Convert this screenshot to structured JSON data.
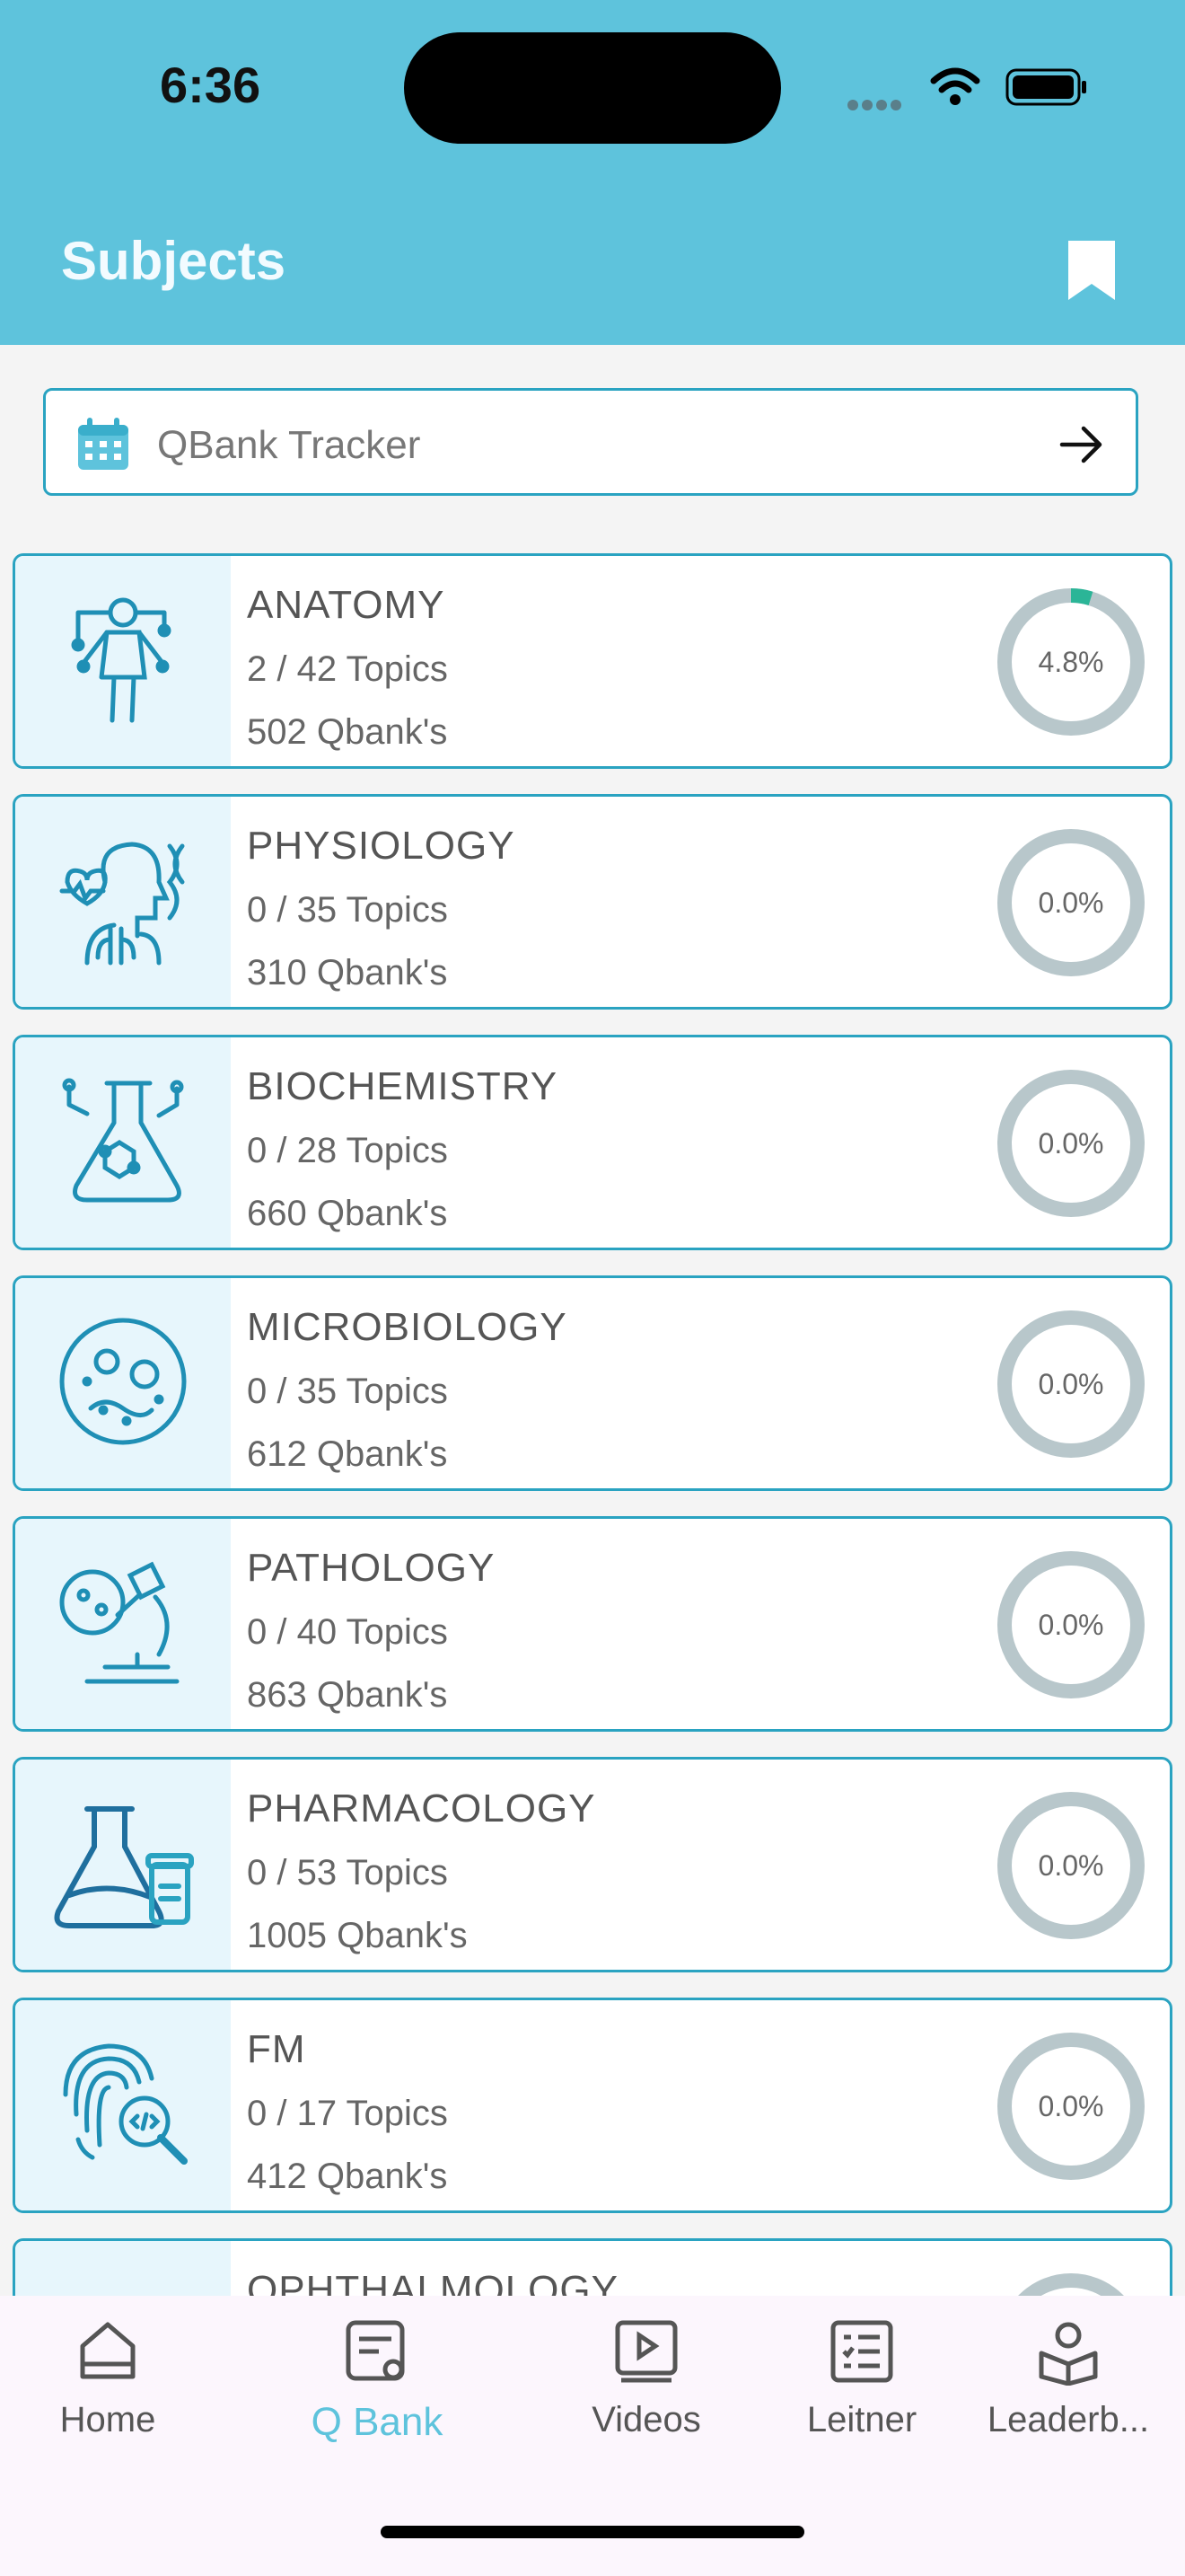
{
  "status": {
    "time": "6:36"
  },
  "header": {
    "title": "Subjects",
    "bookmark_icon": "bookmark-icon"
  },
  "tracker": {
    "label": "QBank Tracker",
    "icon": "calendar-icon",
    "arrow_icon": "arrow-right-icon"
  },
  "colors": {
    "accent": "#5ec3dc",
    "border": "#2aa3c1",
    "progress": "#2bb597",
    "ring_track": "#b8c7cb"
  },
  "subjects": [
    {
      "name": "ANATOMY",
      "topics": "2 / 42 Topics",
      "qbanks": "502 Qbank's",
      "percent_label": "4.8%",
      "progress": 0.048,
      "icon": "human-anatomy-icon"
    },
    {
      "name": "PHYSIOLOGY",
      "topics": "0 / 35 Topics",
      "qbanks": "310 Qbank's",
      "percent_label": "0.0%",
      "progress": 0.0,
      "icon": "physiology-icon"
    },
    {
      "name": "BIOCHEMISTRY",
      "topics": "0 / 28 Topics",
      "qbanks": "660 Qbank's",
      "percent_label": "0.0%",
      "progress": 0.0,
      "icon": "biochemistry-flask-icon"
    },
    {
      "name": "MICROBIOLOGY",
      "topics": "0 / 35 Topics",
      "qbanks": "612 Qbank's",
      "percent_label": "0.0%",
      "progress": 0.0,
      "icon": "microbes-petri-icon"
    },
    {
      "name": "PATHOLOGY",
      "topics": "0 / 40 Topics",
      "qbanks": "863 Qbank's",
      "percent_label": "0.0%",
      "progress": 0.0,
      "icon": "microscope-icon"
    },
    {
      "name": "PHARMACOLOGY",
      "topics": "0 / 53 Topics",
      "qbanks": "1005 Qbank's",
      "percent_label": "0.0%",
      "progress": 0.0,
      "icon": "flask-pill-bottle-icon"
    },
    {
      "name": "FM",
      "topics": "0 / 17 Topics",
      "qbanks": "412 Qbank's",
      "percent_label": "0.0%",
      "progress": 0.0,
      "icon": "fingerprint-search-icon"
    },
    {
      "name": "OPHTHALMOLOGY",
      "topics": "",
      "qbanks": "",
      "percent_label": "",
      "progress": 0.0,
      "icon": "eye-icon"
    }
  ],
  "tabbar": [
    {
      "label": "Home",
      "icon": "home-icon",
      "active": false
    },
    {
      "label": "Q Bank",
      "icon": "qbank-icon",
      "active": true
    },
    {
      "label": "Videos",
      "icon": "video-play-icon",
      "active": false
    },
    {
      "label": "Leitner",
      "icon": "checklist-icon",
      "active": false
    },
    {
      "label": "Leaderb...",
      "icon": "leaderboard-icon",
      "active": false
    }
  ]
}
